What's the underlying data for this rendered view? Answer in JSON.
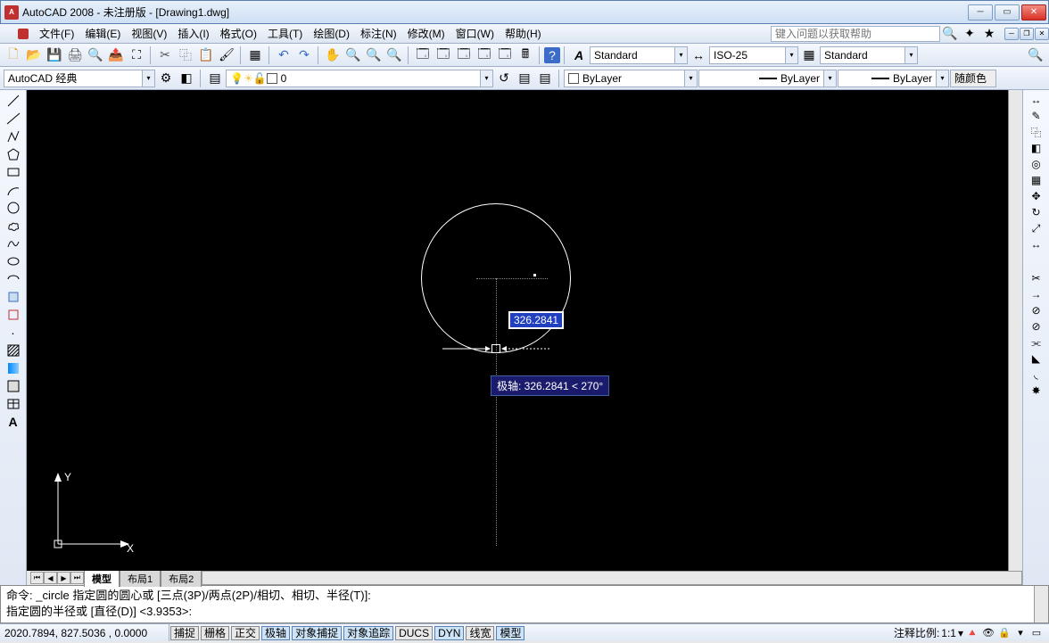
{
  "title": "AutoCAD 2008 - 未注册版 - [Drawing1.dwg]",
  "menu": {
    "file": "文件(F)",
    "edit": "编辑(E)",
    "view": "视图(V)",
    "insert": "插入(I)",
    "format": "格式(O)",
    "tools": "工具(T)",
    "draw": "绘图(D)",
    "dimension": "标注(N)",
    "modify": "修改(M)",
    "window": "窗口(W)",
    "help": "帮助(H)"
  },
  "help_search_placeholder": "键入问题以获取帮助",
  "workspace": "AutoCAD 经典",
  "layer_current": "0",
  "props": {
    "bylinetype": "ByLayer",
    "bylayer_line": "ByLayer",
    "bylayer_weight": "ByLayer",
    "bycolor": "随颜色"
  },
  "styles": {
    "text_style": "Standard",
    "dim_style": "ISO-25",
    "table_style": "Standard"
  },
  "tabs": {
    "model": "模型",
    "layout1": "布局1",
    "layout2": "布局2"
  },
  "dynamic_input": "326.2841",
  "polar_tooltip": "极轴: 326.2841 < 270°",
  "ucs": {
    "x": "X",
    "y": "Y"
  },
  "command": {
    "line1": "命令: _circle 指定圆的圆心或 [三点(3P)/两点(2P)/相切、相切、半径(T)]:",
    "line2": "指定圆的半径或 [直径(D)] <3.9353>:"
  },
  "status": {
    "coords": "2020.7894, 827.5036 , 0.0000",
    "snap": "捕捉",
    "grid": "栅格",
    "ortho": "正交",
    "polar": "极轴",
    "osnap": "对象捕捉",
    "otrack": "对象追踪",
    "ducs": "DUCS",
    "dyn": "DYN",
    "lwt": "线宽",
    "model": "模型",
    "annoscale_label": "注释比例:",
    "annoscale_value": "1:1"
  }
}
